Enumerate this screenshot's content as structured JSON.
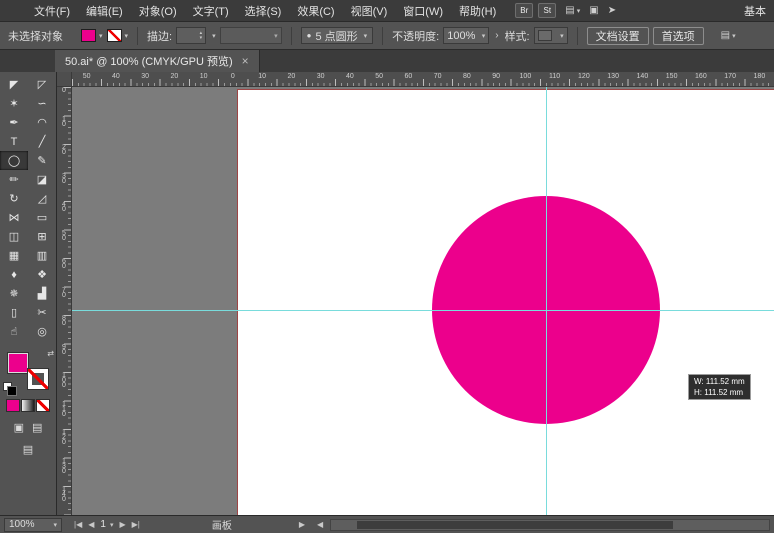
{
  "colors": {
    "accent_pink": "#ec008c",
    "guide_cyan": "#79dcdc",
    "artboard_border": "#9e4545"
  },
  "glyphs": {
    "caret_down": "▾",
    "caret_up": "▴",
    "chevron_right": "›",
    "swap": "⇄",
    "share": "➤",
    "panel": "▤",
    "grid": "▣",
    "bullet": "●"
  },
  "menubar": {
    "items": [
      {
        "name": "menu-file",
        "label": "文件(F)"
      },
      {
        "name": "menu-edit",
        "label": "编辑(E)"
      },
      {
        "name": "menu-object",
        "label": "对象(O)"
      },
      {
        "name": "menu-type",
        "label": "文字(T)"
      },
      {
        "name": "menu-select",
        "label": "选择(S)"
      },
      {
        "name": "menu-effect",
        "label": "效果(C)"
      },
      {
        "name": "menu-view",
        "label": "视图(V)"
      },
      {
        "name": "menu-window",
        "label": "窗口(W)"
      },
      {
        "name": "menu-help",
        "label": "帮助(H)"
      }
    ],
    "br_badge": "Br",
    "st_badge": "St",
    "workspace": "基本"
  },
  "controlbar": {
    "no_selection": "未选择对象",
    "stroke_label": "描边:",
    "brush_name": "5 点圆形",
    "opacity_label": "不透明度:",
    "opacity_value": "100%",
    "style_label": "样式:",
    "document_setup": "文档设置",
    "preferences": "首选项"
  },
  "tabbar": {
    "title": "50.ai* @ 100% (CMYK/GPU 预览)",
    "close_label": "×"
  },
  "toolbar": {
    "active_tool": "ellipse-tool-icon",
    "tools": [
      {
        "name": "selection-tool-icon",
        "glyph": "◤"
      },
      {
        "name": "direct-selection-tool-icon",
        "glyph": "◸"
      },
      {
        "name": "magic-wand-tool-icon",
        "glyph": "✶"
      },
      {
        "name": "lasso-tool-icon",
        "glyph": "∽"
      },
      {
        "name": "pen-tool-icon",
        "glyph": "✒"
      },
      {
        "name": "curvature-tool-icon",
        "glyph": "◠"
      },
      {
        "name": "type-tool-icon",
        "glyph": "T"
      },
      {
        "name": "line-segment-tool-icon",
        "glyph": "╱"
      },
      {
        "name": "ellipse-tool-icon",
        "glyph": "◯"
      },
      {
        "name": "paintbrush-tool-icon",
        "glyph": "✎"
      },
      {
        "name": "pencil-tool-icon",
        "glyph": "✏"
      },
      {
        "name": "eraser-tool-icon",
        "glyph": "◪"
      },
      {
        "name": "rotate-tool-icon",
        "glyph": "↻"
      },
      {
        "name": "scale-tool-icon",
        "glyph": "◿"
      },
      {
        "name": "width-tool-icon",
        "glyph": "⋈"
      },
      {
        "name": "free-transform-tool-icon",
        "glyph": "▭"
      },
      {
        "name": "shape-builder-tool-icon",
        "glyph": "◫"
      },
      {
        "name": "perspective-grid-tool-icon",
        "glyph": "⊞"
      },
      {
        "name": "mesh-tool-icon",
        "glyph": "▦"
      },
      {
        "name": "gradient-tool-icon",
        "glyph": "▥"
      },
      {
        "name": "eyedropper-tool-icon",
        "glyph": "♦"
      },
      {
        "name": "blend-tool-icon",
        "glyph": "❖"
      },
      {
        "name": "symbol-sprayer-tool-icon",
        "glyph": "✵"
      },
      {
        "name": "column-graph-tool-icon",
        "glyph": "▟"
      },
      {
        "name": "artboard-tool-icon",
        "glyph": "▯"
      },
      {
        "name": "slice-tool-icon",
        "glyph": "✂"
      },
      {
        "name": "hand-tool-icon",
        "glyph": "☝"
      },
      {
        "name": "zoom-tool-icon",
        "glyph": "◎"
      }
    ]
  },
  "rulers": {
    "horizontal": [
      "50",
      "40",
      "30",
      "20",
      "10",
      "0",
      "10",
      "20",
      "30",
      "40",
      "50",
      "60",
      "70",
      "80",
      "90",
      "100",
      "110",
      "120",
      "130",
      "140",
      "150",
      "160",
      "170",
      "180"
    ],
    "vertical": [
      "0",
      "10",
      "20",
      "30",
      "40",
      "50",
      "60",
      "70",
      "80",
      "90",
      "100",
      "110",
      "120",
      "130",
      "140"
    ]
  },
  "canvas": {
    "tooltip": {
      "width_label": "W: 111.52 mm",
      "height_label": "H: 111.52 mm"
    }
  },
  "statusbar": {
    "zoom_value": "100%",
    "nav": {
      "first": "|◀",
      "prev": "◀",
      "current": "1",
      "next": "▶",
      "last": "▶|"
    },
    "status_label": "画板",
    "scroll_right": "▶",
    "scroll_left": "◀"
  }
}
